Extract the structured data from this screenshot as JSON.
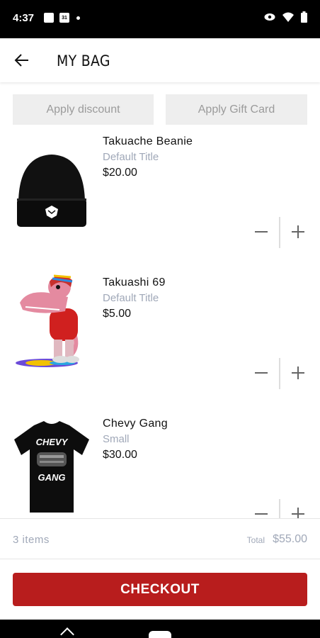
{
  "status": {
    "time": "4:37",
    "calendar": "31"
  },
  "header": {
    "title": "MY BAG"
  },
  "promo": {
    "discount_label": "Apply discount",
    "gift_label": "Apply Gift Card"
  },
  "items": [
    {
      "name": "Takuache Beanie",
      "variant": "Default Title",
      "price": "$20.00",
      "image": "beanie-image"
    },
    {
      "name": "Takuashi 69",
      "variant": "Default Title",
      "price": "$5.00",
      "image": "character-sticker-image"
    },
    {
      "name": "Chevy Gang",
      "variant": "Small",
      "price": "$30.00",
      "image": "tshirt-image",
      "shirt_text_top": "CHEVY",
      "shirt_text_bottom": "GANG"
    }
  ],
  "summary": {
    "count": "3 items",
    "total_label": "Total",
    "total_value": "$55.00"
  },
  "checkout": {
    "label": "CHECKOUT"
  },
  "colors": {
    "accent": "#b81d1d",
    "muted": "#a0a8b8",
    "promo_bg": "#eeeeee"
  }
}
